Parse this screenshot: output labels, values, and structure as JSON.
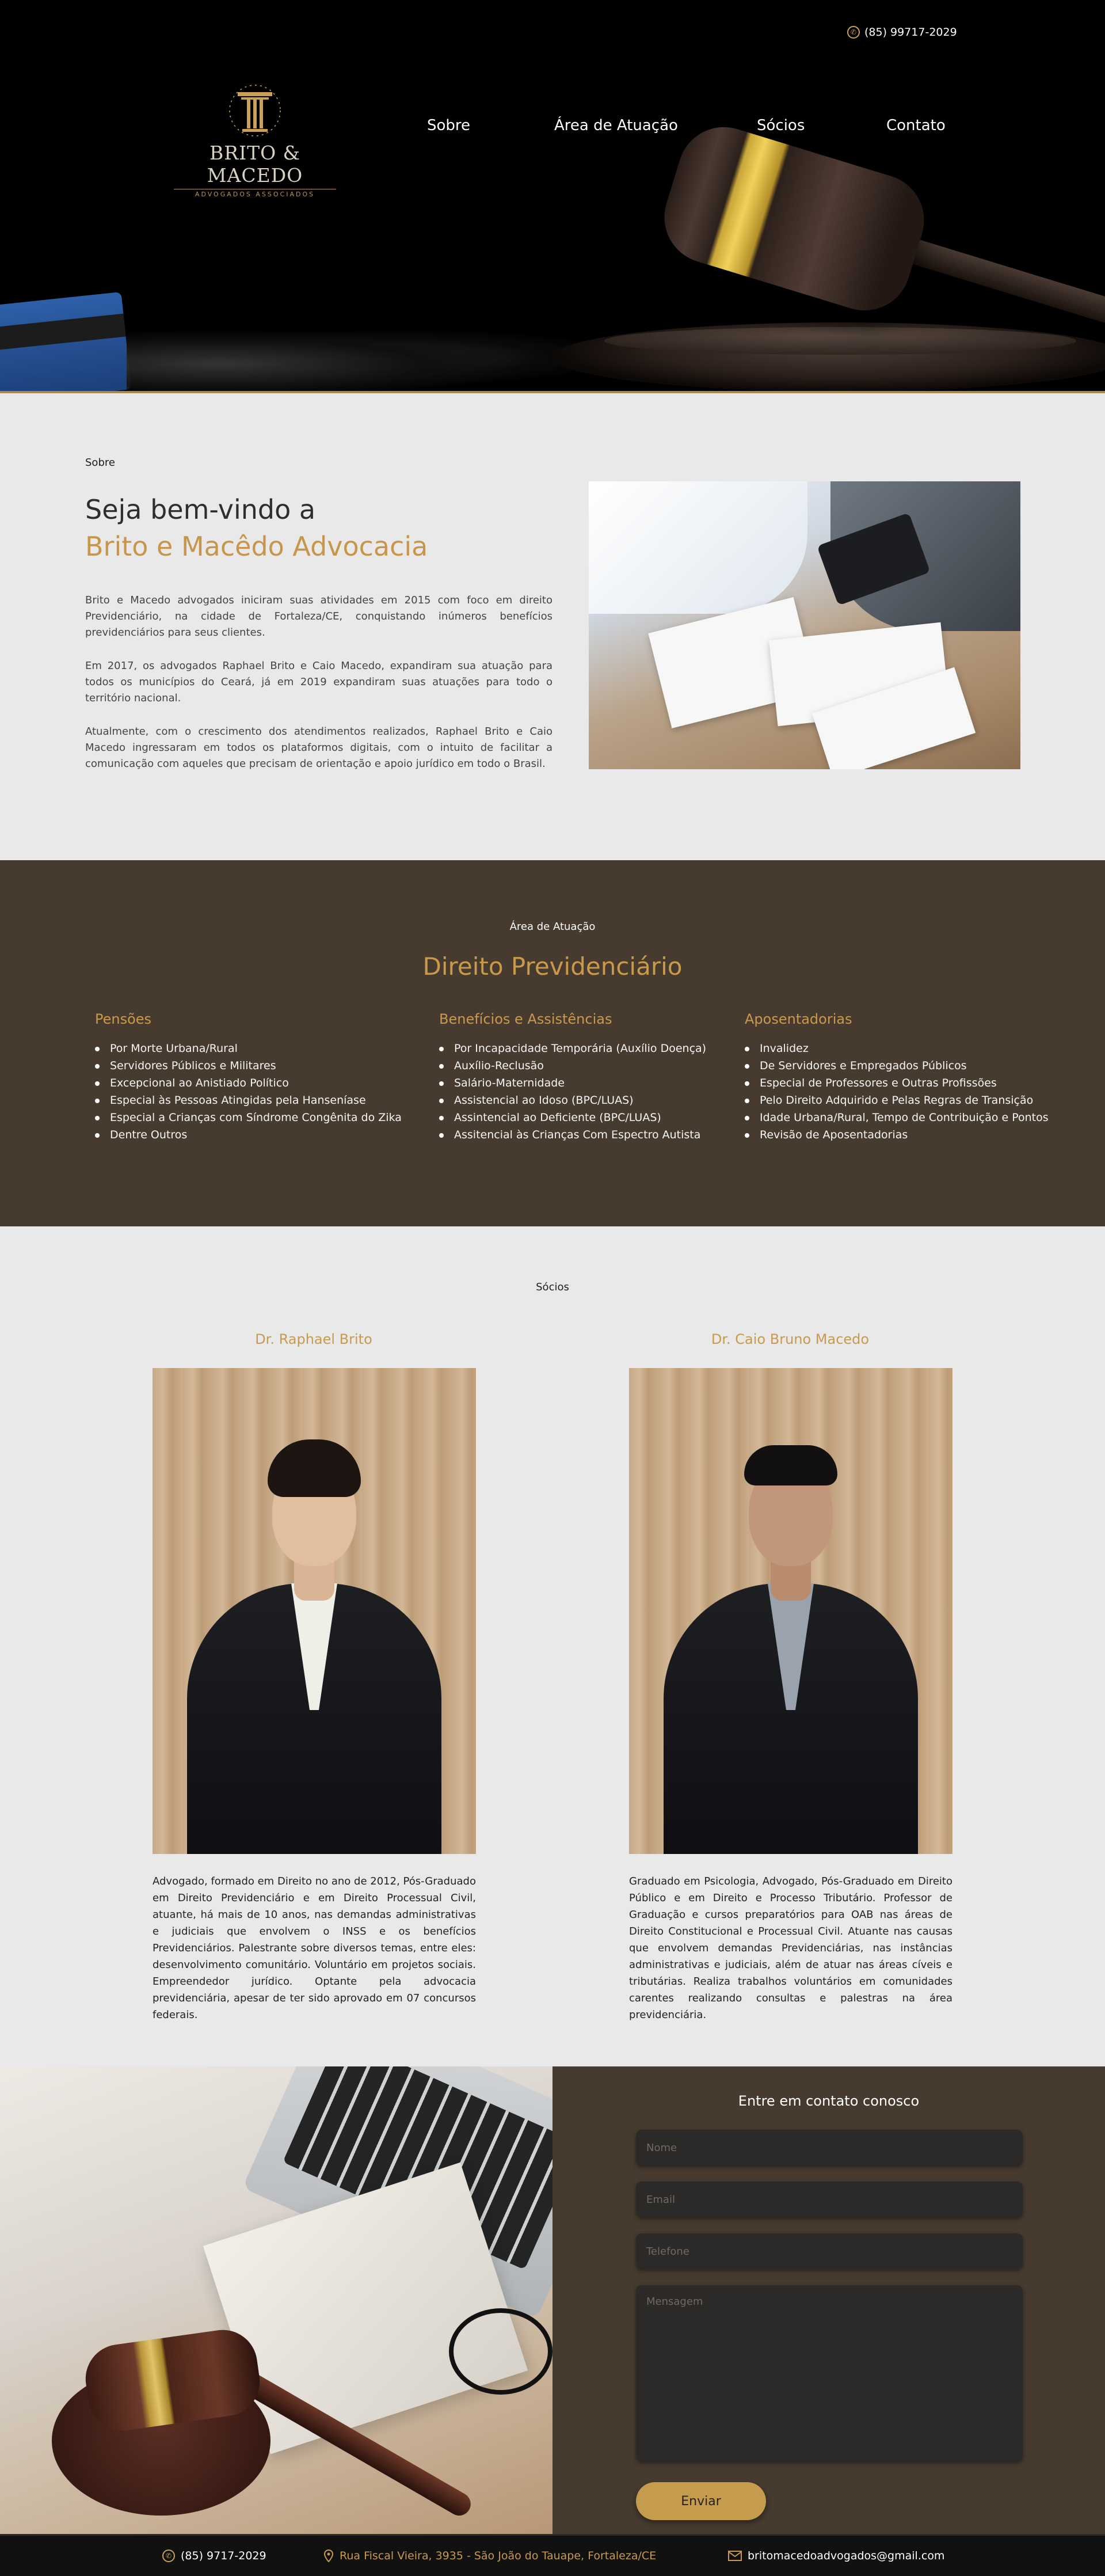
{
  "header": {
    "phone": "(85) 99717-2029",
    "logo": {
      "brand": "BRITO & MACEDO",
      "subtitle": "ADVOGADOS ASSOCIADOS"
    },
    "nav": [
      {
        "label": "Sobre"
      },
      {
        "label": "Área de Atuação"
      },
      {
        "label": "Sócios"
      },
      {
        "label": "Contato"
      }
    ]
  },
  "about": {
    "eyebrow": "Sobre",
    "title_line1": "Seja bem-vindo a",
    "title_line2": "Brito e Macêdo Advocacia",
    "paragraphs": [
      "Brito e Macedo advogados iniciram suas atividades em 2015 com foco em direito Previdenciário, na cidade de Fortaleza/CE, conquistando inúmeros benefícios previdenciários para seus clientes.",
      "Em 2017, os advogados Raphael Brito e Caio Macedo, expandiram sua atuação para todos os municípios do Ceará, já em 2019 expandiram suas atuações para todo o território nacional.",
      "Atualmente, com o crescimento dos atendimentos realizados, Raphael Brito e Caio Macedo ingressaram em todos os plataformos digitais, com o intuito de facilitar a comunicação com aqueles que precisam de orientação e apoio jurídico em todo o Brasil."
    ]
  },
  "areas": {
    "eyebrow": "Área de Atuação",
    "title": "Direito Previdenciário",
    "columns": [
      {
        "title": "Pensões",
        "items": [
          "Por Morte Urbana/Rural",
          "Servidores Públicos e Militares",
          "Excepcional ao Anistiado Político",
          "Especial às Pessoas Atingidas pela Hanseníase",
          "Especial a Crianças com Síndrome Congênita do Zika",
          "Dentre Outros"
        ]
      },
      {
        "title": "Benefícios e Assistências",
        "items": [
          "Por Incapacidade Temporária (Auxílio Doença)",
          "Auxílio-Reclusão",
          "Salário-Maternidade",
          "Assistencial ao Idoso (BPC/LUAS)",
          "Assintencial ao Deficiente (BPC/LUAS)",
          "Assitencial às Crianças Com Espectro Autista"
        ]
      },
      {
        "title": "Aposentadorias",
        "items": [
          "Invalidez",
          "De Servidores e Empregados Públicos",
          "Especial de Professores e Outras Profissões",
          "Pelo Direito Adquirido e Pelas Regras de Transição",
          "Idade Urbana/Rural, Tempo de Contribuição e Pontos",
          "Revisão de Aposentadorias"
        ]
      }
    ]
  },
  "partners": {
    "eyebrow": "Sócios",
    "people": [
      {
        "name": "Dr. Raphael Brito",
        "bio": "Advogado, formado em Direito no ano de 2012, Pós-Graduado em Direito Previdenciário e em Direito Processual Civil, atuante, há mais de 10 anos, nas demandas administrativas e judiciais que envolvem o INSS e os benefícios Previdenciários. Palestrante sobre diversos temas, entre eles: desenvolvimento comunitário. Voluntário em projetos sociais. Empreendedor jurídico. Optante pela advocacia previdenciária, apesar de ter sido aprovado em 07 concursos federais."
      },
      {
        "name": "Dr. Caio Bruno Macedo",
        "bio": "Graduado em Psicologia, Advogado, Pós-Graduado em Direito Público e em Direito e Processo Tributário. Professor de Graduação e cursos preparatórios para OAB nas áreas de Direito Constitucional e Processual Civil. Atuante nas causas que envolvem demandas Previdenciárias, nas instâncias administrativas e judiciais, além de atuar nas áreas cíveis e tributárias. Realiza trabalhos voluntários em comunidades carentes realizando consultas e palestras na área previdenciária."
      }
    ]
  },
  "contact": {
    "title": "Entre em contato conosco",
    "name_placeholder": "Nome",
    "email_placeholder": "Email",
    "phone_placeholder": "Telefone",
    "message_placeholder": "Mensagem",
    "send_label": "Enviar"
  },
  "footer": {
    "phone": "(85) 9717-2029",
    "address": "Rua Fiscal Vieira, 3935 - São João do Tauape, Fortaleza/CE",
    "email": "britomacedoadvogados@gmail.com"
  },
  "icons": {
    "phone": "phone-icon",
    "location": "map-pin-icon",
    "email": "envelope-icon",
    "logo": "pillar-logo-icon"
  },
  "colors": {
    "accent": "#c99a4c",
    "dark_brown": "#473b30",
    "light_bg": "#e9e9e9",
    "black": "#000000"
  }
}
